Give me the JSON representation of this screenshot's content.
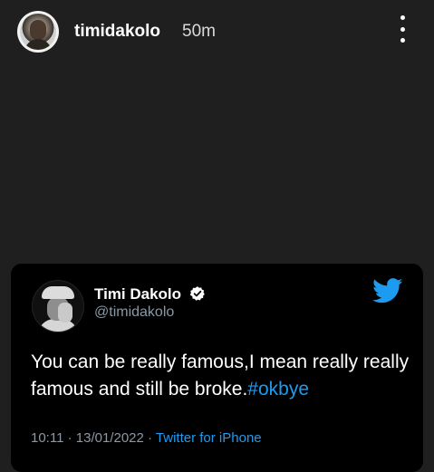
{
  "story": {
    "username": "timidakolo",
    "time_ago": "50m",
    "menu_icon": "more-vertical-icon"
  },
  "tweet": {
    "display_name": "Timi Dakolo",
    "handle": "@timidakolo",
    "verified": true,
    "text_main": "You can be really famous,I mean really really famous and still be broke.",
    "hashtag": "#okbye",
    "time": "10:11",
    "date": "13/01/2022",
    "separator": " · ",
    "source": "Twitter for iPhone",
    "accent_color": "#1d9bf0"
  }
}
